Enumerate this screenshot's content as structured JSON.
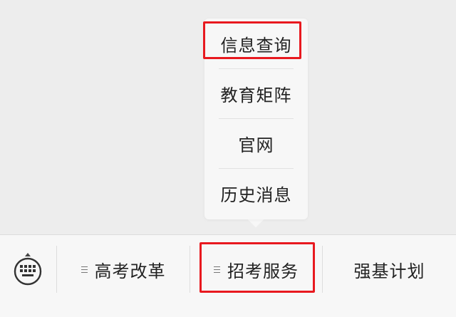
{
  "popup_menu": {
    "items": [
      {
        "label": "信息查询"
      },
      {
        "label": "教育矩阵"
      },
      {
        "label": "官网"
      },
      {
        "label": "历史消息"
      }
    ]
  },
  "menu_bar": {
    "keyboard_icon": "keyboard-icon",
    "tabs": [
      {
        "label": "高考改革",
        "icon": "menu-lines-icon"
      },
      {
        "label": "招考服务",
        "icon": "menu-lines-icon"
      },
      {
        "label": "强基计划"
      }
    ]
  },
  "colors": {
    "background": "#ededed",
    "panel": "#f7f7f7",
    "text": "#222222",
    "highlight": "#e8191f"
  }
}
